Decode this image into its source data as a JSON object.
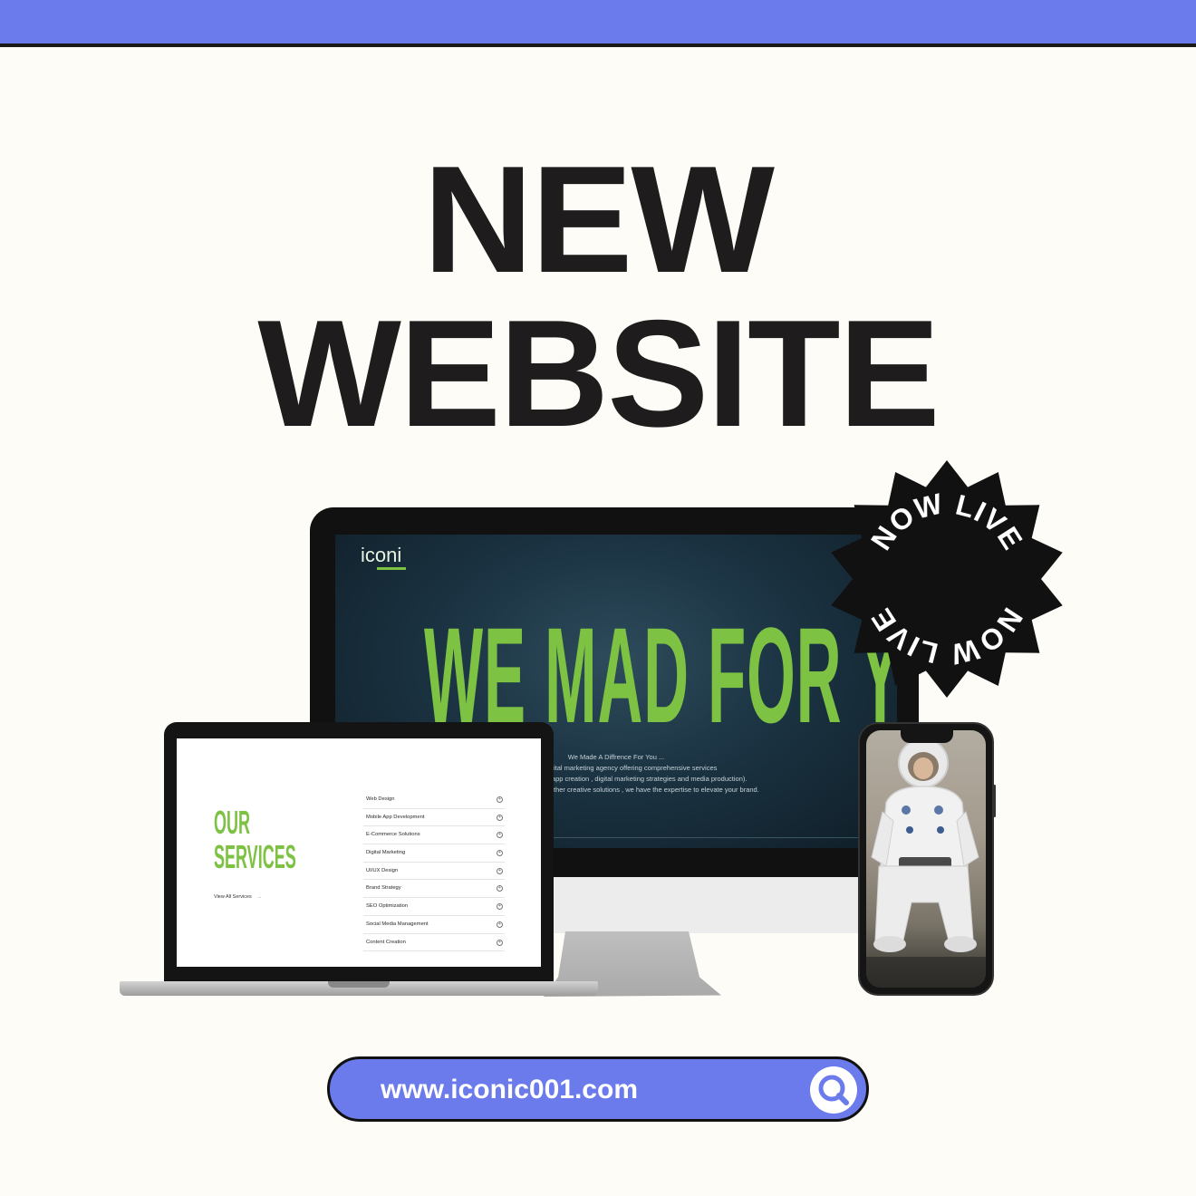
{
  "colors": {
    "accent": "#6b7bec",
    "brand_green": "#7dc242",
    "ink": "#1e1c1c",
    "background": "#fdfcf7"
  },
  "headline": {
    "line1": "NEW",
    "line2": "WEBSITE"
  },
  "badge": {
    "text_top": "NOW LIVE",
    "text_bottom": "NOW LIVE"
  },
  "monitor": {
    "logo": "iconi",
    "hero": "WE MAD FOR YOU",
    "copy": [
      "We Made A Diffrence For You ...",
      "We are a digital marketing agency offering comprehensive services",
      "development , mobile app creation , digital marketing strategies and media production).",
      "ggers , event planning or other creative solutions , we have the expertise to elevate your brand."
    ]
  },
  "laptop": {
    "title_line1": "OUR",
    "title_line2": "SERVICES",
    "view_all": "View All Services",
    "services": [
      "Web Design",
      "Mobile App Development",
      "E-Commerce Solutions",
      "Digital Marketing",
      "UI/UX Design",
      "Brand Strategy",
      "SEO Optimization",
      "Social Media Management",
      "Content Creation"
    ]
  },
  "phone": {
    "image": "astronaut-with-laptop"
  },
  "urlbar": {
    "url": "www.iconic001.com",
    "icon": "search-icon"
  }
}
